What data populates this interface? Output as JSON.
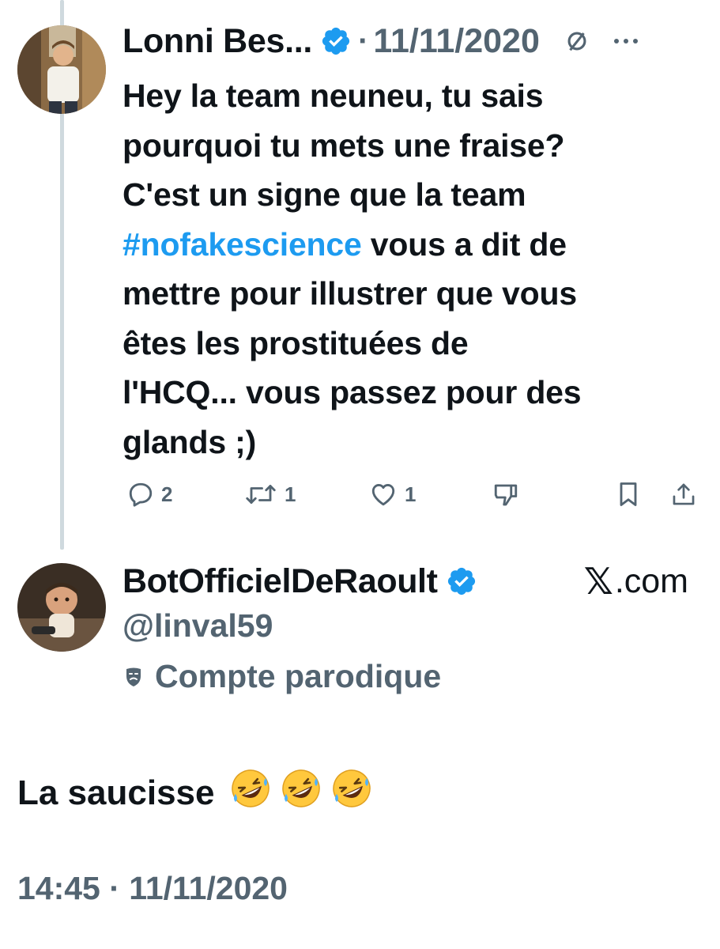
{
  "tweet": {
    "author_name": "Lonni Bes...",
    "separator": "·",
    "date": "11/11/2020",
    "text_before_hashtag": "Hey la team neuneu, tu sais\npourquoi tu mets une fraise?\nC'est un signe que la team\n",
    "hashtag": "#nofakescience",
    "text_after_hashtag": " vous a dit de\nmettre pour illustrer que vous\nêtes les prostituées de\nl'HCQ... vous passez pour des\nglands ;)",
    "actions": {
      "replies": "2",
      "retweets": "1",
      "likes": "1"
    }
  },
  "reply": {
    "author_name": "BotOfficielDeRaoult",
    "site_mark": "𝕏",
    "site_suffix": ".com",
    "handle": "@linval59",
    "parody_label": "Compte parodique",
    "text": "La saucisse",
    "timestamp": "14:45 · 11/11/2020"
  },
  "colors": {
    "accent": "#1d9bf0",
    "muted": "#536471",
    "text": "#0f1419",
    "thread_line": "#cfd9de",
    "emoji_face": "#ffc83d"
  }
}
